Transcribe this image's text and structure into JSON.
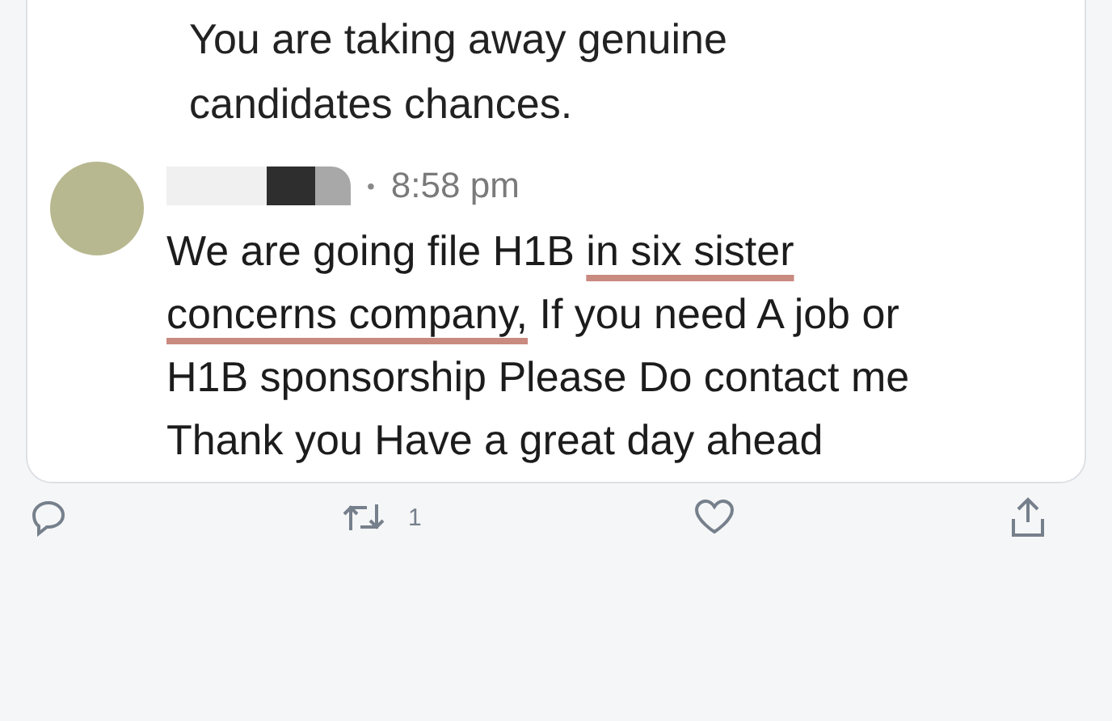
{
  "previous_reply": {
    "text": "You are taking away genuine candidates chances."
  },
  "reply": {
    "separator": "•",
    "time": "8:58 pm",
    "body": [
      {
        "text": "We are going file H1B ",
        "underlined": false
      },
      {
        "text": "in six sister concerns company,",
        "underlined": true
      },
      {
        "text": " If you need A job or H1B sponsorship Please Do contact me Thank you Have a great day ahead",
        "underlined": false
      }
    ]
  },
  "actions": [
    {
      "kind": "reply"
    },
    {
      "kind": "retweet",
      "count": "1"
    },
    {
      "kind": "like"
    },
    {
      "kind": "share"
    }
  ]
}
